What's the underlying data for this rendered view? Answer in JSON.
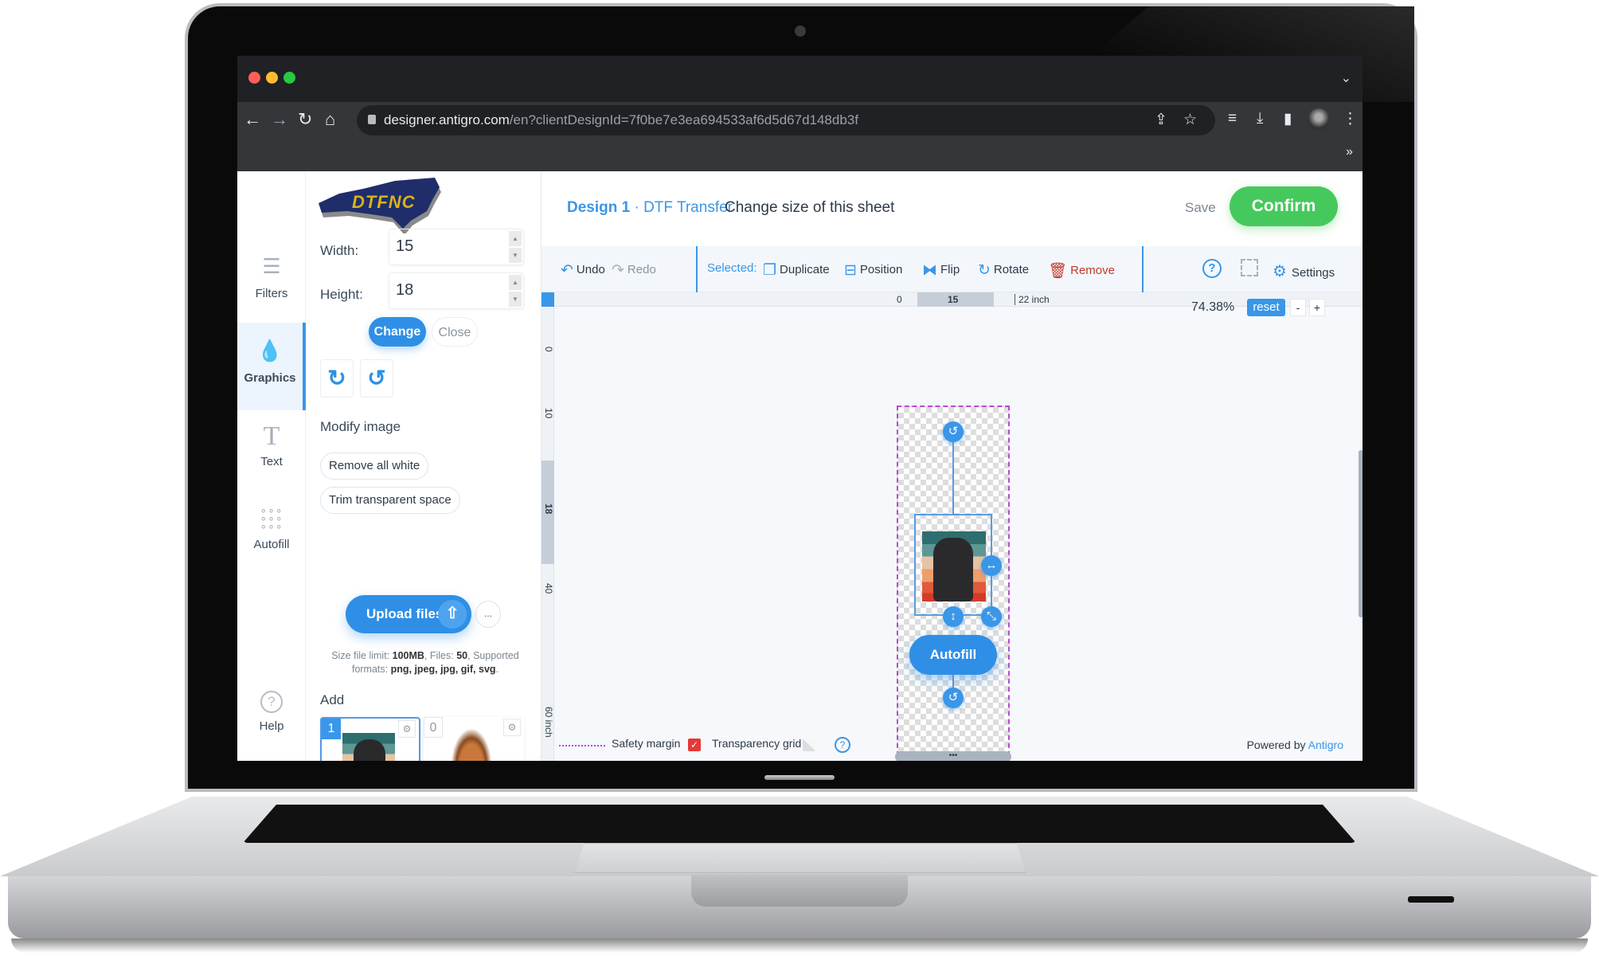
{
  "browser": {
    "url_host": "designer.antigro.com",
    "url_path": "/en?clientDesignId=7f0be7e3ea694533af6d5d67d148db3f",
    "traffic_lights": {
      "close": "#ff5f57",
      "minimize": "#febc2e",
      "maximize": "#28c840"
    },
    "icons": [
      "back-icon",
      "forward-icon",
      "reload-icon",
      "home-icon",
      "lock-icon",
      "share-icon",
      "star-icon",
      "reading-list-icon",
      "download-icon",
      "sidebar-icon",
      "profile-avatar",
      "menu-icon",
      "bookmarks-overflow-icon"
    ]
  },
  "rail": {
    "items": [
      {
        "label": "Filters",
        "icon": "sliders-icon"
      },
      {
        "label": "Graphics",
        "icon": "drop-icon",
        "active": true
      },
      {
        "label": "Text",
        "icon": "text-t-icon"
      },
      {
        "label": "Autofill",
        "icon": "grid-dots-icon"
      },
      {
        "label": "Help",
        "icon": "question-icon"
      }
    ]
  },
  "panel": {
    "logo_text": "DTFNC",
    "width_label": "Width:",
    "width_value": "15",
    "height_label": "Height:",
    "height_value": "18",
    "change_label": "Change",
    "close_label": "Close",
    "modify_label": "Modify image",
    "remove_white_label": "Remove all white",
    "trim_label": "Trim transparent space",
    "upload_label": "Upload files",
    "more_label": "...",
    "limits": {
      "prefix": "Size file limit: ",
      "size": "100MB",
      "files_prefix": ", Files: ",
      "files": "50",
      "formats_prefix": ", Supported formats: ",
      "formats": "png, jpeg, jpg, gif, svg",
      "suffix": "."
    },
    "add_label": "Add",
    "thumbs": [
      {
        "count": "1",
        "subject": "black cat with coffee",
        "selected": true
      },
      {
        "count": "0",
        "subject": "lynx face",
        "selected": false
      }
    ]
  },
  "header": {
    "design_name": "Design 1",
    "design_type": " · DTF Transfer",
    "sheet_link": "Change size of this sheet",
    "save_label": "Save",
    "confirm_label": "Confirm",
    "confirm_color": "#46c95c"
  },
  "actions": {
    "undo": "Undo",
    "redo": "Redo",
    "selected": "Selected:",
    "duplicate": "Duplicate",
    "position": "Position",
    "flip": "Flip",
    "rotate": "Rotate",
    "remove": "Remove",
    "settings": "Settings"
  },
  "ruler": {
    "h_start": "0",
    "h_selected": "15",
    "h_end": "22 inch",
    "v_ticks": [
      "0",
      "10",
      "18",
      "40",
      "60 inch"
    ]
  },
  "zoom": {
    "percent": "74.38%",
    "reset": "reset",
    "minus": "-",
    "plus": "+"
  },
  "canvas": {
    "autofill_label": "Autofill"
  },
  "footer": {
    "safety_margin": "Safety margin",
    "safety_margin_checked": true,
    "transparency_grid": "Transparency grid",
    "transparency_grid_checked": false,
    "powered_by": "Powered by ",
    "brand": "Antigro",
    "scroll_handle": "•••"
  },
  "accent_color": "#3a96e8"
}
